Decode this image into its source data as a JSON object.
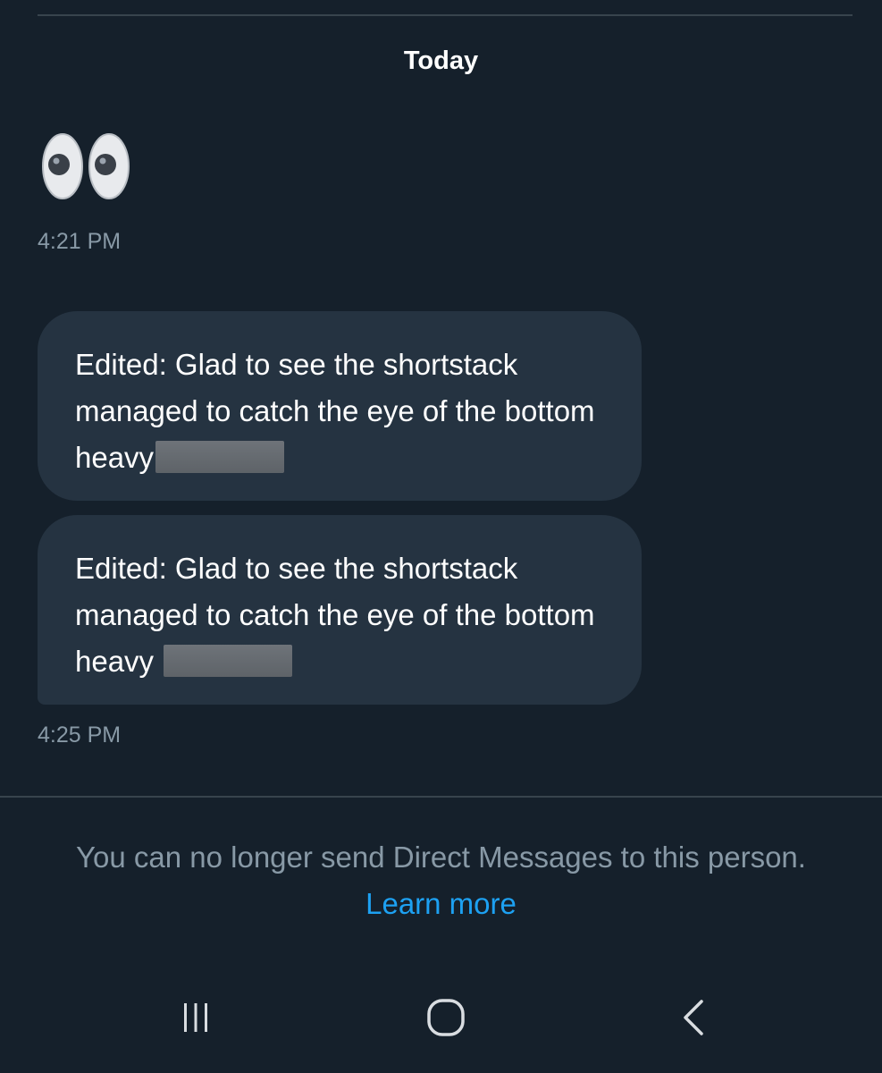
{
  "header": {
    "date_label": "Today"
  },
  "messages": [
    {
      "type": "emoji",
      "emoji": "eyes-icon",
      "time": "4:21 PM"
    },
    {
      "type": "text",
      "text": "Edited: Glad to see the shortstack managed to catch the eye of the bottom heavy",
      "redacted": true
    },
    {
      "type": "text",
      "text": "Edited: Glad to see the shortstack managed to catch the eye of the bottom heavy",
      "redacted": true,
      "time": "4:25 PM"
    }
  ],
  "footer": {
    "notice": "You can no longer send Direct Messages to this person.",
    "learn_more": "Learn more"
  },
  "nav": {
    "recents": "recents-icon",
    "home": "home-icon",
    "back": "back-icon"
  },
  "colors": {
    "background": "#15202b",
    "bubble": "#253341",
    "accent": "#1da1f2",
    "muted_text": "#8899a6"
  }
}
